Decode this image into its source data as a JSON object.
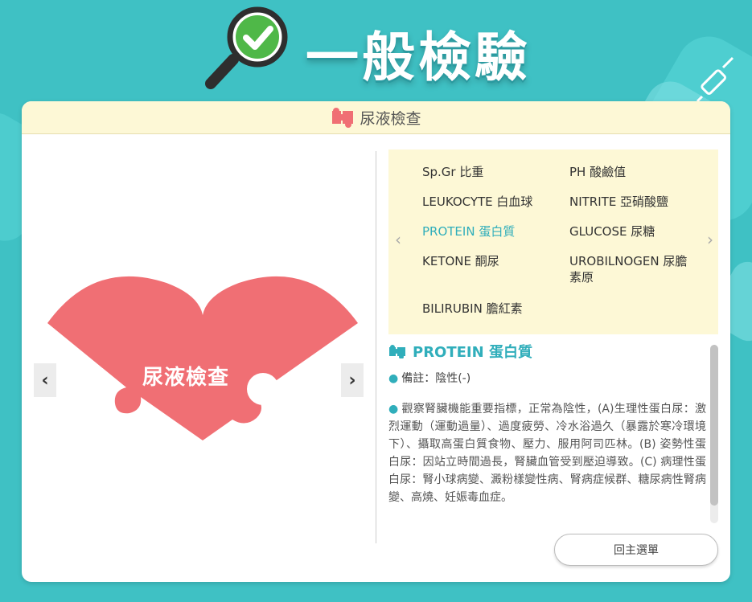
{
  "page": {
    "title": "一般檢驗"
  },
  "card": {
    "header_label": "尿液檢查"
  },
  "left": {
    "heart_label": "尿液檢查",
    "prev_glyph": "‹",
    "next_glyph": "›"
  },
  "items": [
    {
      "label": "Sp.Gr 比重"
    },
    {
      "label": "PH 酸鹼值"
    },
    {
      "label": "LEUKOCYTE 白血球"
    },
    {
      "label": "NITRITE 亞硝酸鹽"
    },
    {
      "label": "PROTEIN 蛋白質",
      "active": true
    },
    {
      "label": "GLUCOSE 尿糖"
    },
    {
      "label": "KETONE 酮尿"
    },
    {
      "label": "UROBILNOGEN 尿膽素原"
    },
    {
      "label": "BILIRUBIN 膽紅素"
    }
  ],
  "item_nav": {
    "prev": "‹",
    "next": "›"
  },
  "detail": {
    "title": "PROTEIN 蛋白質",
    "note": "備註：陰性(-)",
    "description": "觀察腎臟機能重要指標，正常為陰性，(A)生理性蛋白尿：激烈運動（運動過量）、過度疲勞、冷水浴過久（暴露於寒冷環境下）、攝取高蛋白質食物、壓力、服用阿司匹林。(B) 姿勢性蛋白尿：因站立時間過長，腎臟血管受到壓迫導致。(C) 病理性蛋白尿：腎小球病變、澱粉樣變性病、腎病症候群、糖尿病性腎病變、高燒、妊娠毒血症。",
    "bullet": "●"
  },
  "back_button": {
    "label": "回主選單"
  },
  "colors": {
    "accent": "#30aebb",
    "heart": "#f06f74",
    "background": "#3fc1c4",
    "header_bg": "#fdf8d6"
  },
  "icons": {
    "title_icon": "magnifier-check-icon",
    "header_icon": "puzzle-icon",
    "deco_icon": "syringe-icon"
  }
}
